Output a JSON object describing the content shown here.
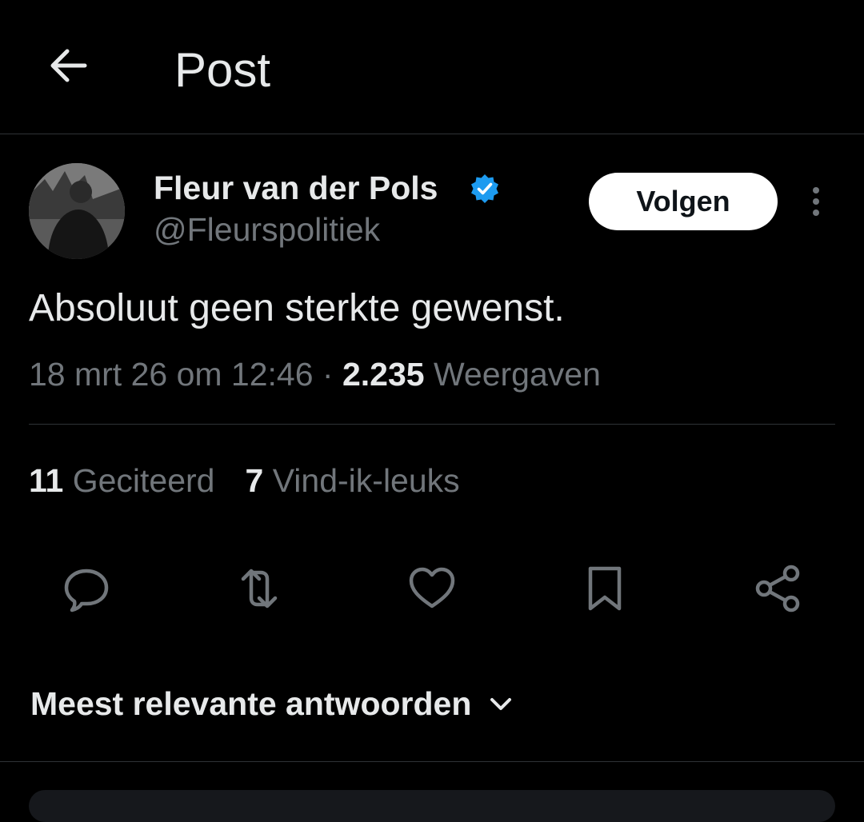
{
  "header": {
    "title": "Post",
    "back_icon": "arrow-left-icon"
  },
  "author": {
    "name": "Fleur van der Pols",
    "handle": "@Fleurspolitiek",
    "verified": true,
    "verified_color": "#1d9bf0"
  },
  "follow_button": {
    "label": "Volgen"
  },
  "post": {
    "text": "Absoluut geen sterkte gewenst.",
    "date": "18 mrt 26 om 12:46",
    "separator": " · ",
    "views_count": "2.235",
    "views_label": " Weergaven"
  },
  "stats": {
    "quotes_count": "11",
    "quotes_label": " Geciteerd",
    "likes_count": "7",
    "likes_label": " Vind-ik-leuks"
  },
  "actions": [
    "reply-icon",
    "repost-icon",
    "like-icon",
    "bookmark-icon",
    "share-icon"
  ],
  "replies": {
    "sort_label": "Meest relevante antwoorden"
  },
  "colors": {
    "background": "#000000",
    "text": "#e7e9ea",
    "muted": "#71767b",
    "divider": "#2f3336"
  }
}
